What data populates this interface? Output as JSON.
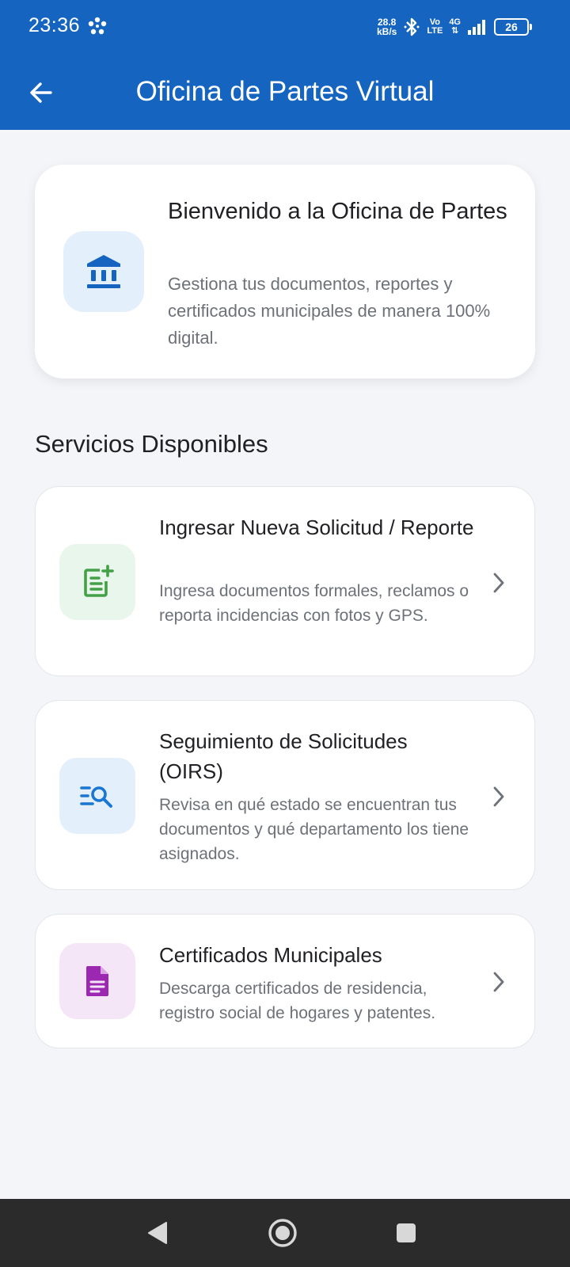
{
  "status_bar": {
    "time": "23:36",
    "speed_value": "28.8",
    "speed_unit": "kB/s",
    "volte_top": "Vo",
    "volte_bottom": "LTE",
    "network": "4G",
    "battery": "26"
  },
  "app_bar": {
    "title": "Oficina de Partes Virtual",
    "back_icon": "arrow-left-icon"
  },
  "welcome": {
    "title": "Bienvenido a la Oficina de Partes",
    "description": "Gestiona tus documentos, reportes y certificados municipales de manera 100% digital.",
    "icon": "bank-icon"
  },
  "section_title": "Servicios Disponibles",
  "services": [
    {
      "title": "Ingresar Nueva Solicitud / Reporte",
      "description": "Ingresa documentos formales, reclamos o reporta incidencias con fotos y GPS.",
      "icon": "note-add-icon"
    },
    {
      "title": "Seguimiento de Solicitudes (OIRS)",
      "description": "Revisa en qué estado se encuentran tus documentos y qué departamento los tiene asignados.",
      "icon": "list-search-icon"
    },
    {
      "title": "Certificados Municipales",
      "description": "Descarga certificados de residencia, registro social de hogares y patentes.",
      "icon": "document-icon"
    }
  ],
  "colors": {
    "primary": "#1565c0",
    "background": "#f3f5f9",
    "green_icon": "#43a047",
    "blue_icon": "#1976d2",
    "purple_icon": "#9c27b0"
  }
}
